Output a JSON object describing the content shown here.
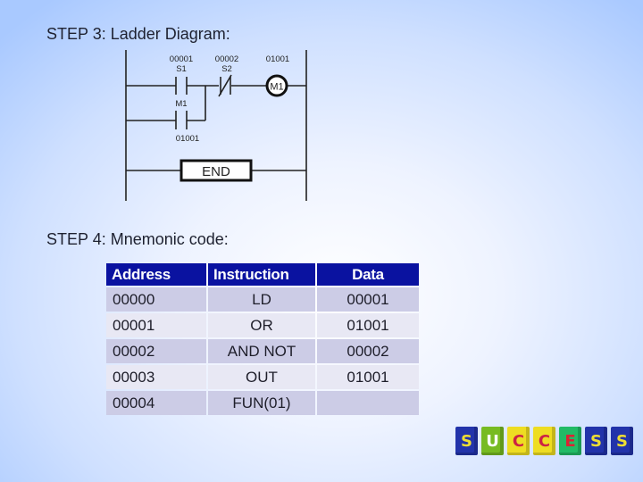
{
  "step3": {
    "title": "STEP 3: Ladder Diagram:"
  },
  "ladder": {
    "contact_s1": {
      "address": "00001",
      "label": "S1",
      "type": "normally-open"
    },
    "contact_s2": {
      "address": "00002",
      "label": "S2",
      "type": "normally-closed"
    },
    "coil": {
      "address": "01001",
      "label": "M1"
    },
    "branch_contact": {
      "label": "M1",
      "address": "01001",
      "type": "normally-open"
    },
    "end_label": "END"
  },
  "step4": {
    "title": "STEP 4: Mnemonic code:"
  },
  "mnemonic_table": {
    "headers": [
      "Address",
      "Instruction",
      "Data"
    ],
    "rows": [
      [
        "00000",
        "LD",
        "00001"
      ],
      [
        "00001",
        "OR",
        "01001"
      ],
      [
        "00002",
        "AND NOT",
        "00002"
      ],
      [
        "00003",
        "OUT",
        "01001"
      ],
      [
        "00004",
        "FUN(01)",
        ""
      ]
    ]
  },
  "success_image": {
    "letters": [
      "S",
      "U",
      "C",
      "C",
      "E",
      "S",
      "S"
    ],
    "cube_colors": [
      "#2233aa",
      "#77bb22",
      "#eedd22",
      "#eedd22",
      "#22bb66",
      "#2233aa",
      "#2233aa"
    ],
    "letter_colors": [
      "#eedd33",
      "#ffffff",
      "#cc2244",
      "#cc2244",
      "#dd2233",
      "#eedd33",
      "#eedd33"
    ]
  },
  "colors": {
    "table_header": "#0a12a0",
    "row_odd": "#cccce6",
    "row_even": "#e8e8f4"
  }
}
